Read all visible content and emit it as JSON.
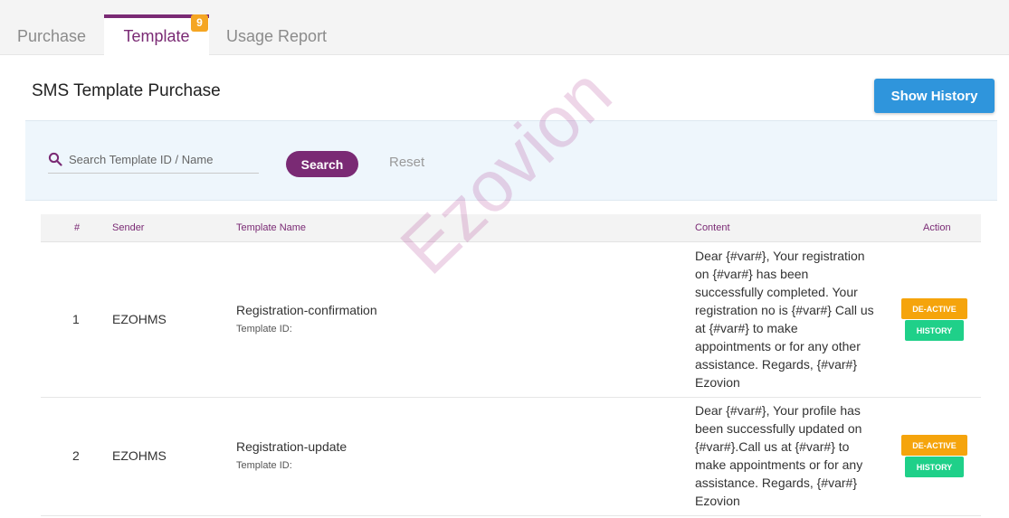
{
  "tabs": [
    {
      "label": "Purchase"
    },
    {
      "label": "Template",
      "badge": "9"
    },
    {
      "label": "Usage Report"
    }
  ],
  "page": {
    "title": "SMS Template Purchase",
    "history_button": "Show History"
  },
  "filter": {
    "search_placeholder": "Search Template ID / Name",
    "search_button": "Search",
    "reset_button": "Reset"
  },
  "table": {
    "columns": [
      "#",
      "Sender",
      "Template Name",
      "Content",
      "Action"
    ],
    "rows": [
      {
        "index": "1",
        "sender": "EZOHMS",
        "template_name": "Registration-confirmation",
        "template_id_label": "Template ID:",
        "content": "Dear {#var#}, Your registration on {#var#} has been successfully completed. Your registration no is {#var#} Call us at {#var#} to make appointments or for any other assistance. Regards, {#var#} Ezovion",
        "action_primary": "DE-ACTIVE",
        "action_secondary": "HISTORY"
      },
      {
        "index": "2",
        "sender": "EZOHMS",
        "template_name": "Registration-update",
        "template_id_label": "Template ID:",
        "content": "Dear {#var#}, Your profile has been successfully updated on {#var#}.Call us at {#var#} to make appointments or for any assistance. Regards, {#var#} Ezovion",
        "action_primary": "DE-ACTIVE",
        "action_secondary": "HISTORY"
      }
    ]
  },
  "watermark": "Ezovion",
  "colors": {
    "brand": "#7a2a74",
    "primary_button": "#2f95dc",
    "warning": "#f5a40c",
    "success": "#1fd089",
    "badge": "#f5a623"
  },
  "icons": {
    "search": "search-icon"
  }
}
